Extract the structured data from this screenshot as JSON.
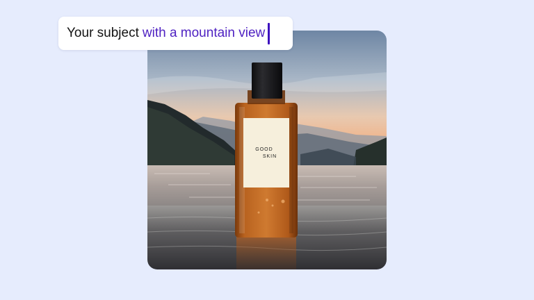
{
  "prompt": {
    "base_text": "Your subject",
    "highlight_text": "with a mountain view"
  },
  "product": {
    "label_line1": "GOOD",
    "label_line2": "SKIN"
  },
  "colors": {
    "background": "#e6ecfd",
    "highlight": "#4f22c2",
    "caret": "#3d0fbf"
  }
}
